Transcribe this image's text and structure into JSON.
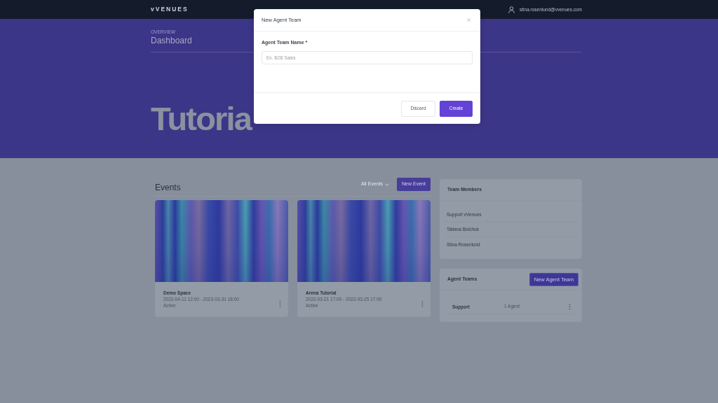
{
  "navbar": {
    "logo": "vVENUES",
    "user_email": "stina.rosenlund@vvenues.com"
  },
  "header": {
    "eyebrow": "OVERVIEW",
    "title": "Dashboard",
    "hero_title": "Tutoria"
  },
  "events": {
    "title": "Events",
    "filter": "All Events",
    "new_button": "New Event",
    "cards": [
      {
        "name": "Demo Space",
        "dates": "2022-04-11 12:00 - 2023-03-31 18:00",
        "status": "Active"
      },
      {
        "name": "Arena Tutorial",
        "dates": "2022-03-21 17:00 - 2022-03-25 17:00",
        "status": "Active"
      }
    ]
  },
  "team_members": {
    "title": "Team Members",
    "members": [
      "Support vVenues",
      "Tatiana Boichuk",
      "Stina Rosenlund"
    ]
  },
  "agent_teams": {
    "title": "Agent Teams",
    "new_button": "New Agent Team",
    "teams": [
      {
        "name": "Support",
        "agents": "1 Agent"
      }
    ]
  },
  "modal": {
    "title": "New Agent Team",
    "field": {
      "label": "Agent Team Name *",
      "placeholder": "Ex. B2B Sales"
    },
    "buttons": [
      {
        "label": "Discard",
        "kind": "secondary"
      },
      {
        "label": "Create",
        "kind": "primary"
      }
    ]
  }
}
